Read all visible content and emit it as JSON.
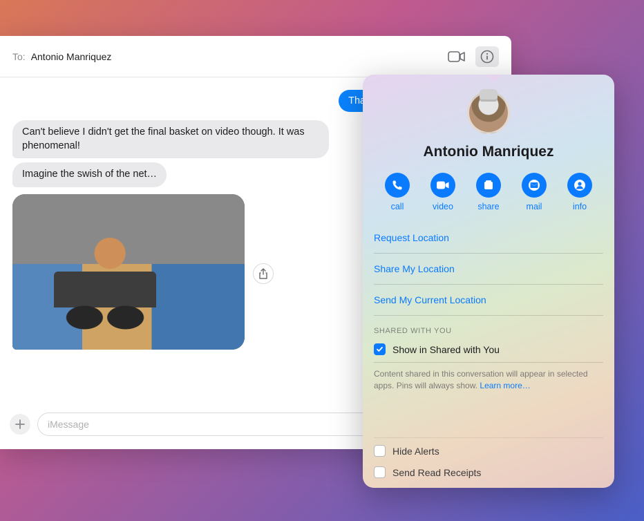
{
  "header": {
    "to_label": "To:",
    "to_name": "Antonio Manriquez"
  },
  "messages": {
    "outgoing_0": "Thanks for coming to the game!",
    "incoming_0": "Can't believe I didn't get the final basket on video though. It was phenomenal!",
    "incoming_1": "Imagine the swish of the net…"
  },
  "composer": {
    "placeholder": "iMessage"
  },
  "popover": {
    "name": "Antonio Manriquez",
    "actions": {
      "call": "call",
      "video": "video",
      "share": "share",
      "mail": "mail",
      "info": "info"
    },
    "links": {
      "request_location": "Request Location",
      "share_my_location": "Share My Location",
      "send_current_location": "Send My Current Location"
    },
    "shared_section": "Shared with You",
    "show_in_shared": "Show in Shared with You",
    "hint": "Content shared in this conversation will appear in selected apps. Pins will always show. ",
    "learn_more": "Learn more…",
    "hide_alerts": "Hide Alerts",
    "send_read_receipts": "Send Read Receipts"
  }
}
